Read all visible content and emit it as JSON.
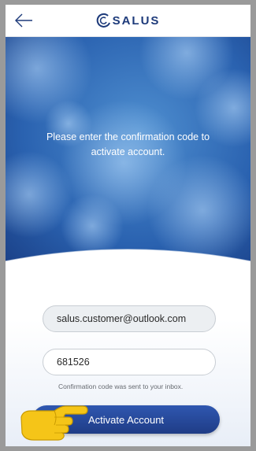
{
  "header": {
    "back_icon": "back-arrow-icon",
    "brand": "SALUS",
    "brand_color": "#1d3a7a"
  },
  "hero": {
    "message": "Please enter the confirmation code to activate account."
  },
  "form": {
    "email_value": "salus.customer@outlook.com",
    "code_value": "681526",
    "hint": "Confirmation code was sent to your inbox.",
    "submit_label": "Activate Account",
    "submit_color": "#2a4c9e"
  },
  "overlay": {
    "pointer_icon": "pointing-hand-icon"
  }
}
